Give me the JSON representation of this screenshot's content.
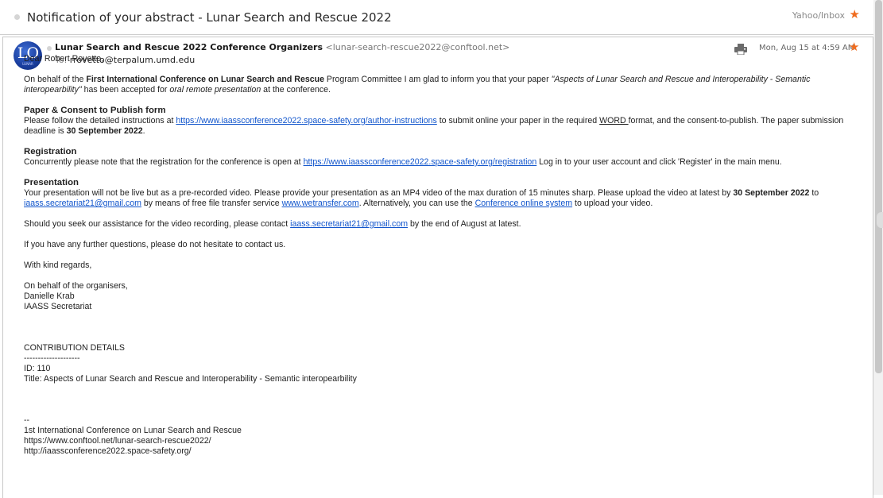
{
  "subject_bar": {
    "subject": "Notification of your abstract - Lunar Search and Rescue 2022",
    "folder": "Yahoo/Inbox"
  },
  "header": {
    "avatar_text": "LO",
    "avatar_sub": "LUNAR",
    "sender_name": "Lunar Search and Rescue 2022 Conference Organizers",
    "sender_email": "<lunar-search-rescue2022@conftool.net>",
    "to_label": "To:",
    "to_value": "rrovetto@terpalum.umd.edu",
    "date": "Mon, Aug 15 at 4:59 AM"
  },
  "body": {
    "greeting": "Dear Robert Rovetto,",
    "p1_a": "On behalf of the ",
    "p1_conf": "First International Conference on Lunar Search and Rescue",
    "p1_b": " Program Committee I am glad to inform you that your paper ",
    "p1_title": "\"Aspects of Lunar Search and Rescue and Interoperability - Semantic interopearbility\"",
    "p1_c": " has been accepted for ",
    "p1_mode": "oral remote presentation",
    "p1_d": " at the conference.",
    "s1_title": "Paper & Consent to Publish form",
    "s1_a": "Please follow the detailed instructions at ",
    "s1_link": "https://www.iaassconference2022.space-safety.org/author-instructions",
    "s1_b": " to submit online your paper in the required ",
    "s1_word": "WORD ",
    "s1_c": "format, and the consent-to-publish. The paper submission deadline is ",
    "s1_deadline": "30 September 2022",
    "s1_d": ".",
    "s2_title": "Registration",
    "s2_a": "Concurrently please note that the registration for the conference is open at ",
    "s2_link": "https://www.iaassconference2022.space-safety.org/registration",
    "s2_b": "  Log in to your user account and click 'Register' in the main menu.",
    "s3_title": "Presentation",
    "s3_a": "Your presentation will not be live but as a pre-recorded video. Please provide your presentation as an MP4 video of the max duration of 15 minutes sharp. Please upload the video at latest by ",
    "s3_deadline": "30 September 2022",
    "s3_b": " to ",
    "s3_email": "iaass.secretariat21@gmail.com",
    "s3_c": " by means of free file transfer service ",
    "s3_wetransfer": "www.wetransfer.com",
    "s3_d": ". Alternatively, you can use the ",
    "s3_conftool": "Conference online system",
    "s3_e": " to upload your video.",
    "p_assist_a": "Should you seek our assistance for the video recording, please contact ",
    "p_assist_email": "iaass.secretariat21@gmail.com",
    "p_assist_b": " by the end of August at latest.",
    "p_questions": "If you have any further questions, please do not hesitate to contact us.",
    "p_regards": "With kind regards,",
    "sig_1": "On behalf of the organisers,",
    "sig_2": "Danielle Krab",
    "sig_3": "IAASS Secretariat",
    "contrib_title": "CONTRIBUTION DETAILS",
    "contrib_rule": "--------------------",
    "contrib_id": "ID: 110",
    "contrib_paper": "Title: Aspects of Lunar Search and Rescue and Interoperability - Semantic interopearbility",
    "footer_dash": "--",
    "footer_1": "1st International Conference on Lunar Search and Rescue",
    "footer_2": "https://www.conftool.net/lunar-search-rescue2022/",
    "footer_3": "http://iaassconference2022.space-safety.org/"
  },
  "colors": {
    "star": "#ef6c1f",
    "link": "#1155cc",
    "avatar": "#1a3fa0"
  },
  "icons": [
    "star-icon",
    "print-icon",
    "avatar"
  ]
}
